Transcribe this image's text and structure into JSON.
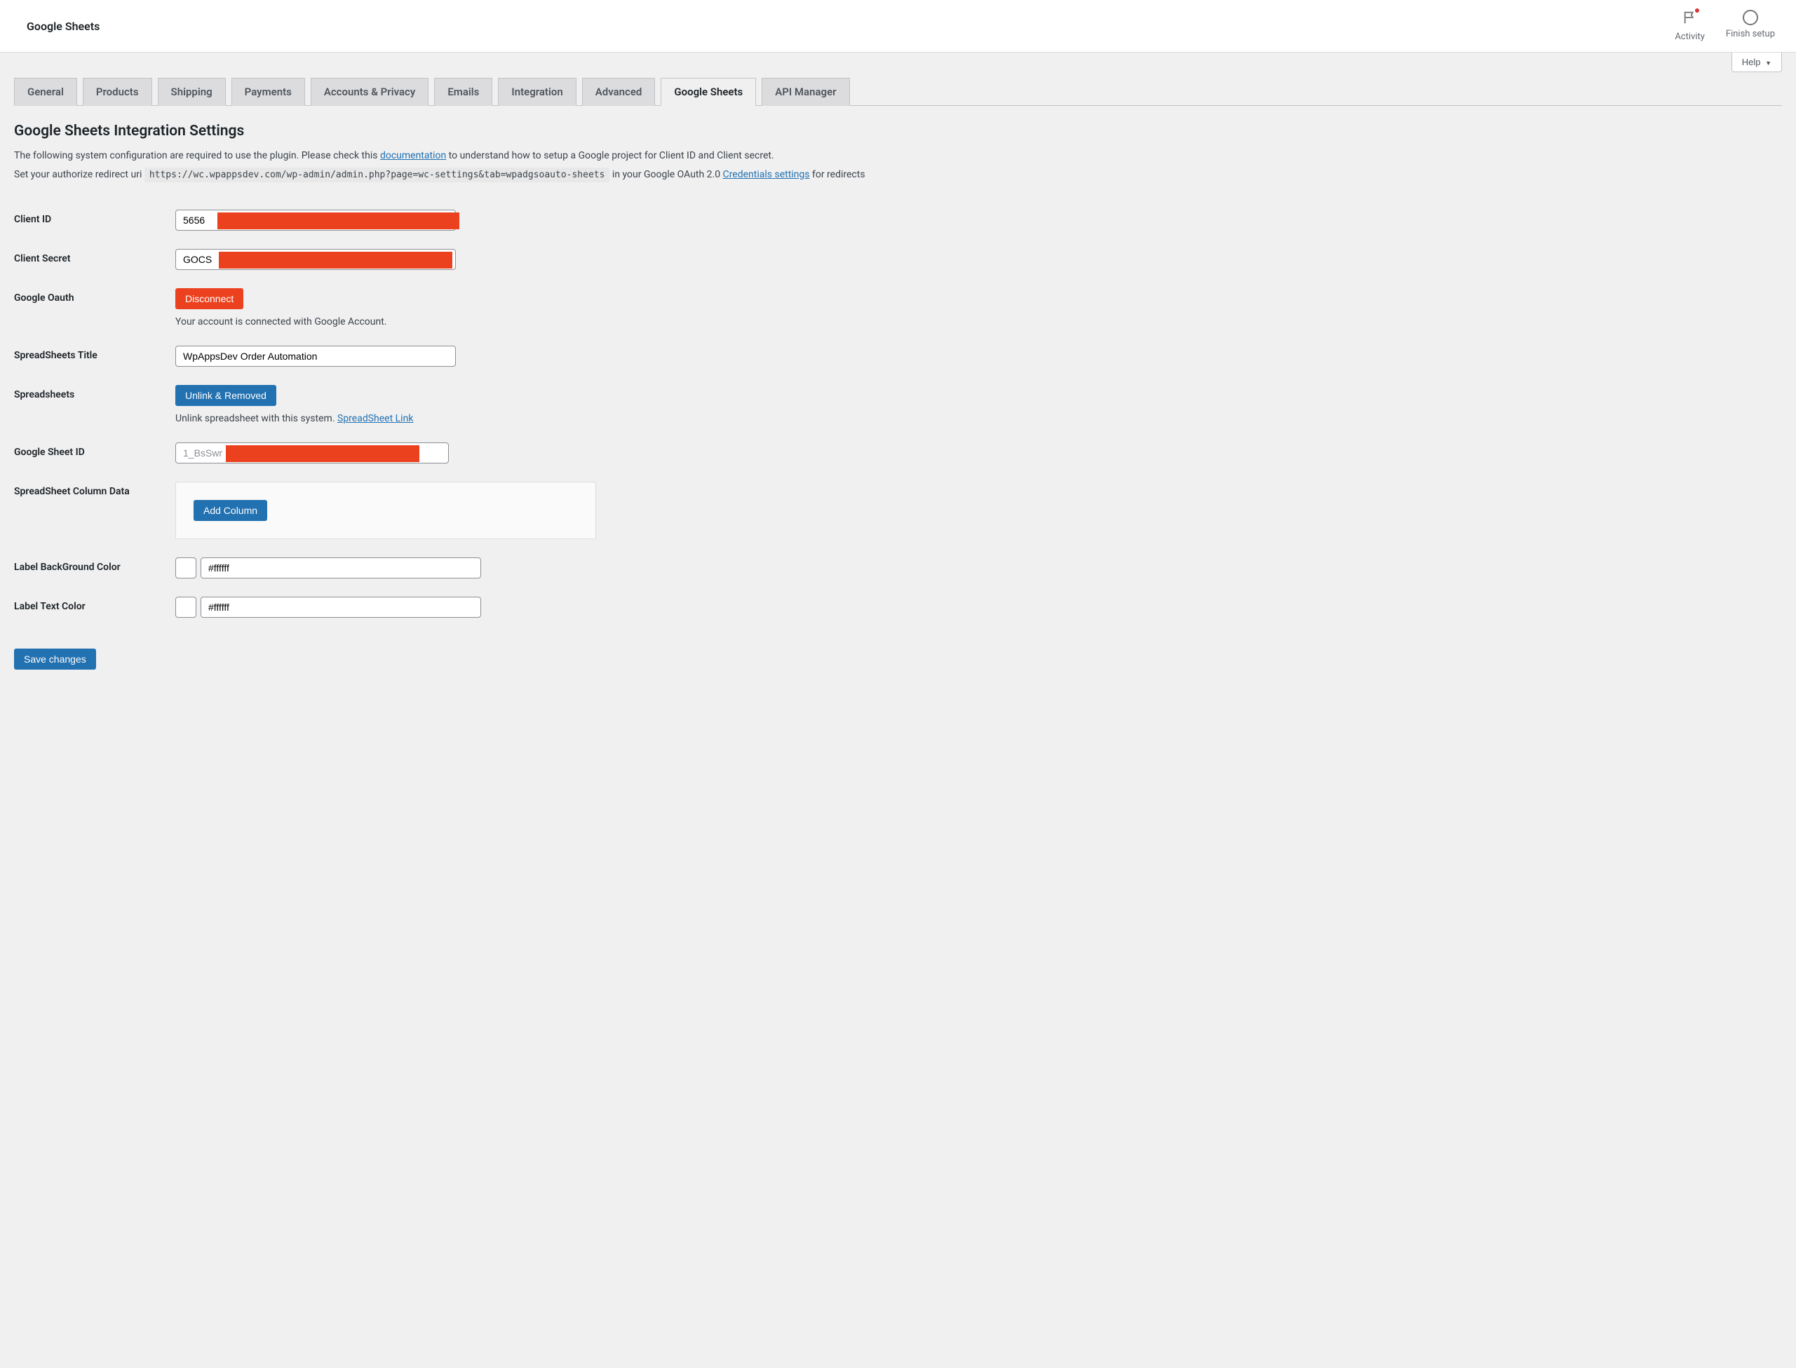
{
  "topbar": {
    "title": "Google Sheets",
    "activity_label": "Activity",
    "finish_label": "Finish setup",
    "help_label": "Help"
  },
  "tabs": [
    {
      "label": "General"
    },
    {
      "label": "Products"
    },
    {
      "label": "Shipping"
    },
    {
      "label": "Payments"
    },
    {
      "label": "Accounts & Privacy"
    },
    {
      "label": "Emails"
    },
    {
      "label": "Integration"
    },
    {
      "label": "Advanced"
    },
    {
      "label": "Google Sheets"
    },
    {
      "label": "API Manager"
    }
  ],
  "heading": "Google Sheets Integration Settings",
  "desc1_pre": "The following system configuration are required to use the plugin. Please check this ",
  "desc1_link": "documentation",
  "desc1_post": " to understand how to setup a Google project for Client ID and Client secret.",
  "desc2_pre": "Set your authorize redirect uri ",
  "desc2_code": "https://wc.wpappsdev.com/wp-admin/admin.php?page=wc-settings&tab=wpadgsoauto-sheets",
  "desc2_mid": " in your Google OAuth 2.0 ",
  "desc2_link": "Credentials settings",
  "desc2_post": " for redirects",
  "fields": {
    "client_id_label": "Client ID",
    "client_id_value": "5656",
    "client_secret_label": "Client Secret",
    "client_secret_value": "GOCS",
    "google_oauth_label": "Google Oauth",
    "disconnect_btn": "Disconnect",
    "oauth_help": "Your account is connected with Google Account.",
    "ss_title_label": "SpreadSheets Title",
    "ss_title_value": "WpAppsDev Order Automation",
    "spreadsheets_label": "Spreadsheets",
    "unlink_btn": "Unlink & Removed",
    "unlink_help_pre": "Unlink spreadsheet with this system. ",
    "unlink_help_link": "SpreadSheet Link",
    "sheet_id_label": "Google Sheet ID",
    "sheet_id_value": "1_BsSwr                                                               rv5o",
    "col_data_label": "SpreadSheet Column Data",
    "add_col_btn": "Add Column",
    "bg_label": "Label BackGround Color",
    "bg_value": "#ffffff",
    "txt_label": "Label Text Color",
    "txt_value": "#ffffff"
  },
  "save_btn": "Save changes"
}
